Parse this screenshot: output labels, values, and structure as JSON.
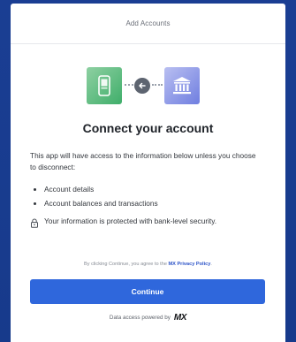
{
  "header": {
    "title": "Add Accounts"
  },
  "hero": {
    "phone_icon": "phone-icon",
    "link_icon": "link-icon",
    "bank_icon": "bank-icon"
  },
  "main": {
    "heading": "Connect your account",
    "intro": "This app will have access to the information below unless you choose to disconnect:",
    "bullets": [
      "Account details",
      "Account balances and transactions"
    ],
    "security_text": "Your information is protected with bank-level security."
  },
  "consent": {
    "prefix": "By clicking Continue, you agree to the",
    "link": "MX Privacy Policy",
    "suffix": "."
  },
  "actions": {
    "continue_label": "Continue"
  },
  "footer": {
    "powered_by": "Data access powered by",
    "brand": "MX"
  },
  "colors": {
    "background": "#14378c",
    "primary_button": "#2f67dc",
    "phone_tile": "#3fae6a",
    "bank_tile": "#6f7ee0",
    "link": "#2d54c8"
  }
}
